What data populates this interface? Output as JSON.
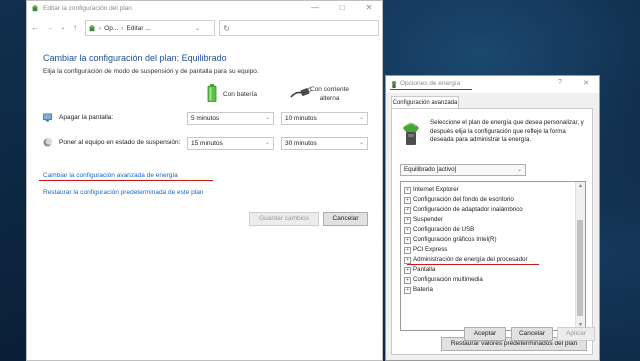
{
  "control_panel": {
    "window_title": "Editar la configuración del plan",
    "breadcrumb_1": "Op...",
    "breadcrumb_sep": "›",
    "breadcrumb_2": "Editar ...",
    "heading": "Cambiar la configuración del plan: Equilibrado",
    "subheading": "Elija la configuración de modo de suspensión y de pantalla para su equipo.",
    "col_battery": "Con batería",
    "col_ac_line1": "Con corriente",
    "col_ac_line2": "alterna",
    "row_display_label": "Apagar la pantalla:",
    "row_sleep_label": "Poner al equipo en estado de suspensión:",
    "display_battery_value": "5 minutos",
    "display_ac_value": "10 minutos",
    "sleep_battery_value": "15 minutos",
    "sleep_ac_value": "30 minutos",
    "link_advanced": "Cambiar la configuración avanzada de energía",
    "link_restore": "Restaurar la configuración predeterminada de este plan",
    "save_button": "Guardar cambios",
    "cancel_button": "Cancelar"
  },
  "power_options": {
    "window_title": "Opciones de energía",
    "help_glyph": "?",
    "close_glyph": "✕",
    "tab_label": "Configuración avanzada",
    "description": "Seleccione el plan de energía que desea personalizar, y después elija la configuración que refleje la forma deseada para administrar la energía.",
    "plan_selected": "Equilibrado [activo]",
    "tree_items": [
      "Internet Explorer",
      "Configuración del fondo de escritorio",
      "Configuración de adaptador inalámbrico",
      "Suspender",
      "Configuración de USB",
      "Configuración gráficos Intel(R)",
      "PCI Express",
      "Administración de energía del procesador",
      "Pantalla",
      "Configuración multimedia",
      "Batería"
    ],
    "restore_button": "Restaurar valores predeterminados del plan",
    "accept_button": "Aceptar",
    "cancel_button": "Cancelar",
    "apply_button": "Aplicar"
  },
  "icons": {
    "titlebar": "power-plan-icon",
    "minimize": "minimize-icon",
    "maximize": "maximize-icon",
    "close": "close-icon",
    "back": "back-arrow-icon",
    "forward": "forward-arrow-icon",
    "recent": "recent-locations-icon",
    "up": "up-arrow-icon",
    "refresh": "refresh-icon",
    "battery": "battery-icon",
    "ac_plug": "power-plug-icon",
    "display": "monitor-icon",
    "sleep": "moon-icon"
  },
  "colors": {
    "heading_blue": "#1e4e9a",
    "link_blue": "#1a6ac0",
    "highlight_red": "#d01818",
    "desktop_bg": "#0f2c4a"
  }
}
